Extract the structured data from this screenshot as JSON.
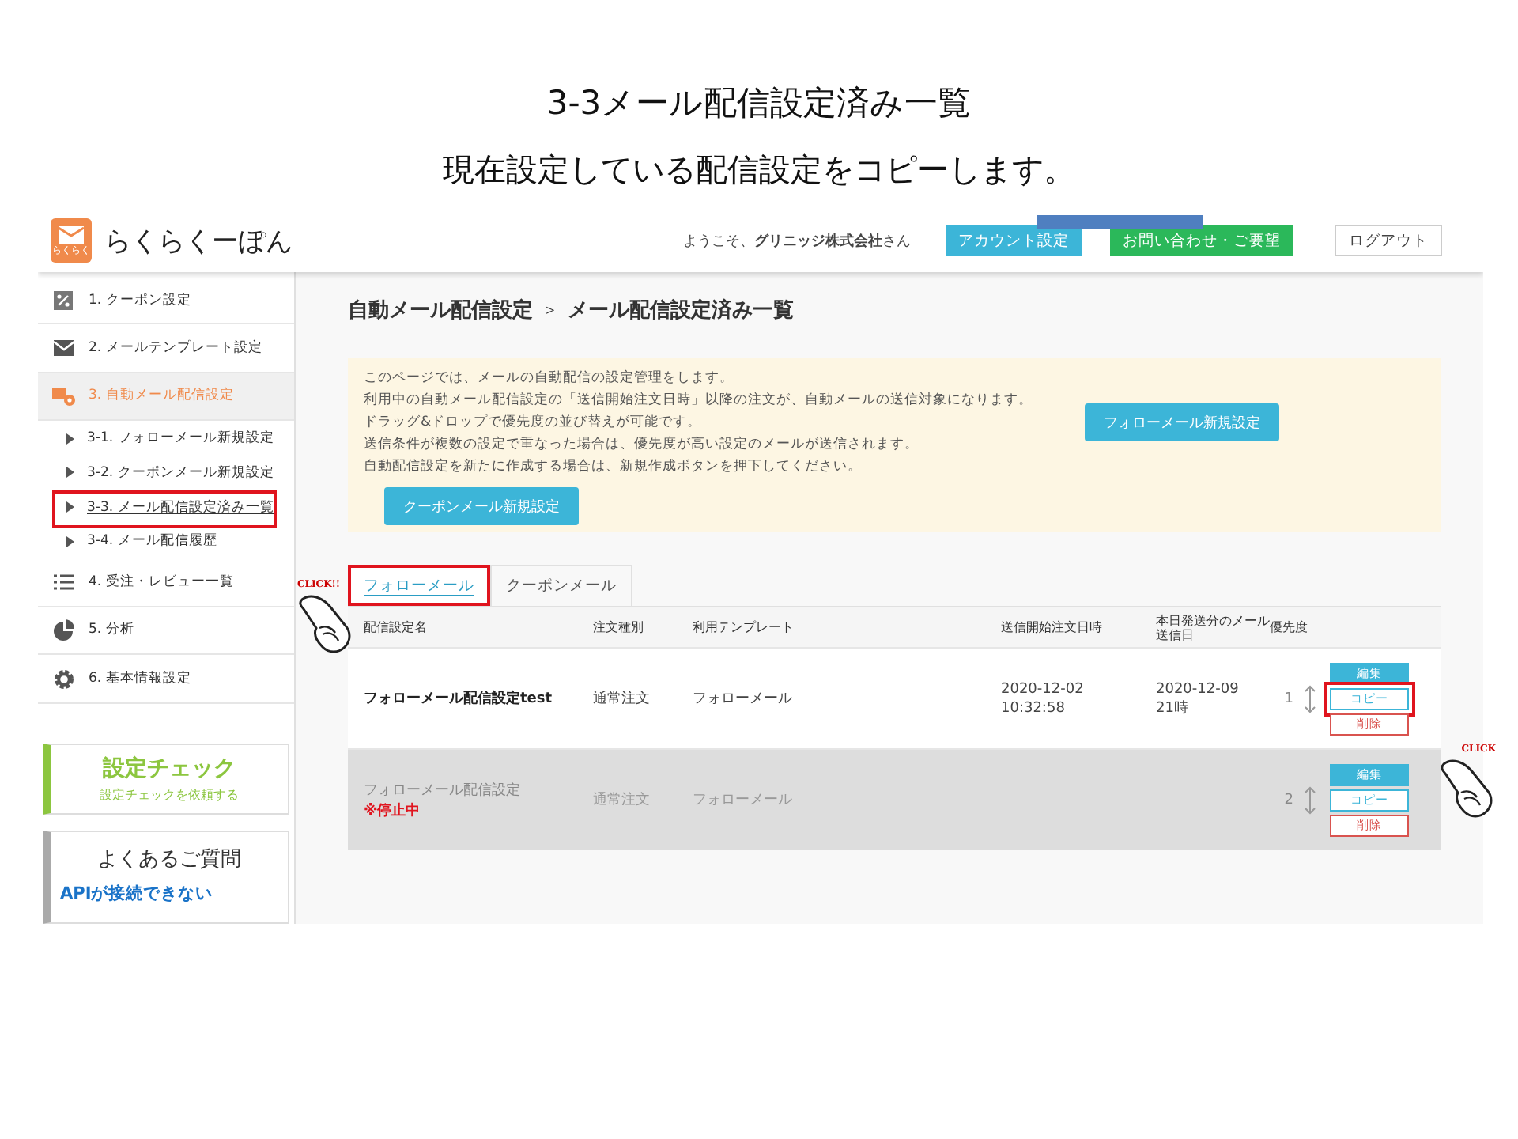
{
  "slide": {
    "title": "3-3メール配信設定済み一覧",
    "subtitle": "現在設定している配信設定をコピーします。"
  },
  "header": {
    "logo_badge": "らくらく",
    "logo_text": "らくらくーぽん",
    "welcome": "ようこそ、**グリニッジ株式会社**さん",
    "buttons": [
      {
        "label": "アカウント設定",
        "kind": "info"
      },
      {
        "label": "お問い合わせ・ご要望",
        "kind": "success"
      },
      {
        "label": "ログアウト",
        "kind": "plain"
      }
    ]
  },
  "sidebar": {
    "items": [
      {
        "label": "1. クーポン設定",
        "selected": false
      },
      {
        "label": "2. メールテンプレート設定",
        "selected": false
      },
      {
        "label": "3. 自動メール配信設定",
        "selected": true,
        "children": [
          {
            "label": "3-1. フォローメール新規設定",
            "current": false,
            "highlighted": false
          },
          {
            "label": "3-2. クーポンメール新規設定",
            "current": false,
            "highlighted": false
          },
          {
            "label": "3-3. メール配信設定済み一覧",
            "current": true,
            "highlighted": true
          },
          {
            "label": "3-4. メール配信履歴",
            "current": false,
            "highlighted": false
          }
        ]
      },
      {
        "label": "4. 受注・レビュー一覧",
        "selected": false
      },
      {
        "label": "5. 分析",
        "selected": false
      },
      {
        "label": "6. 基本情報設定",
        "selected": false
      }
    ],
    "check_card": {
      "title": "設定チェック",
      "subtitle": "設定チェックを依頼する"
    },
    "faq_card": {
      "title": "よくあるご質問",
      "link": "APIが接続できない"
    }
  },
  "main": {
    "breadcrumb": [
      "自動メール配信設定",
      "＞",
      "メール配信設定済み一覧"
    ],
    "notice": {
      "lines": [
        "このページでは、メールの自動配信の設定管理をします。",
        "利用中の自動メール配信設定の「送信開始注文日時」以降の注文が、自動メールの送信対象になります。",
        "ドラッグ&ドロップで優先度の並び替えが可能です。",
        "送信条件が複数の設定で重なった場合は、優先度が高い設定のメールが送信されます。",
        "自動配信設定を新たに作成する場合は、新規作成ボタンを押下してください。"
      ],
      "side_button": "フォローメール新規設定",
      "bottom_button": "クーポンメール新規設定"
    },
    "tabs": [
      {
        "label": "フォローメール",
        "selected": true,
        "highlighted": true
      },
      {
        "label": "クーポンメール",
        "selected": false,
        "highlighted": false
      }
    ],
    "columns": [
      "配信設定名",
      "注文種別",
      "利用テンプレート",
      "送信開始注文日時",
      "本日発送分のメール送信日",
      "優先度"
    ],
    "rows": [
      {
        "name": "フォローメール配信設定test",
        "stopped": false,
        "order_type": "通常注文",
        "template": "フォローメール",
        "start": "2020-12-02\n10:32:58",
        "send": "2020-12-09\n21時",
        "priority": "1",
        "actions": [
          {
            "label": "編集",
            "kind": "edit",
            "highlighted": false
          },
          {
            "label": "コピー",
            "kind": "copy",
            "highlighted": true
          },
          {
            "label": "削除",
            "kind": "delete",
            "highlighted": false
          }
        ]
      },
      {
        "name": "フォローメール配信設定",
        "status": "※停止中",
        "stopped": true,
        "order_type": "通常注文",
        "template": "フォローメール",
        "priority": "2",
        "actions": [
          {
            "label": "編集",
            "kind": "edit",
            "highlighted": false
          },
          {
            "label": "コピー",
            "kind": "copy",
            "highlighted": false
          },
          {
            "label": "削除",
            "kind": "delete",
            "highlighted": false
          }
        ]
      }
    ]
  },
  "callouts": [
    {
      "text": "CLICK!!"
    },
    {
      "text": "CLICK"
    }
  ]
}
